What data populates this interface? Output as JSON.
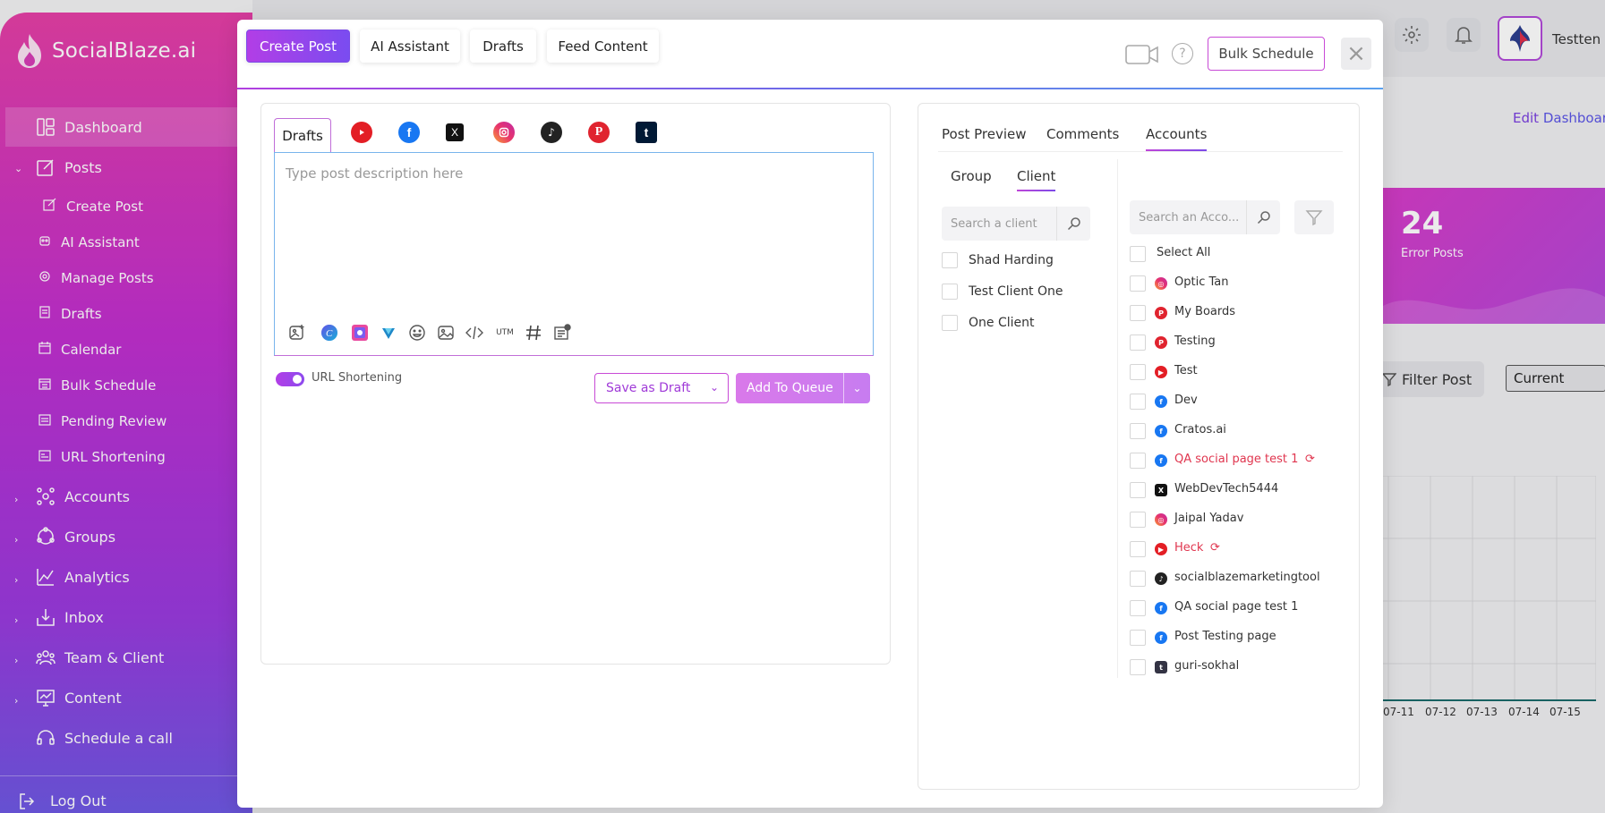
{
  "app": {
    "brand": "SocialBlaze.ai",
    "username": "Testten",
    "edit_dashboard": [
      "Edit",
      "Dashboard"
    ]
  },
  "sidebar": {
    "items": [
      {
        "label": "Dashboard",
        "icon": "dashboard-icon"
      },
      {
        "label": "Posts",
        "icon": "posts-icon"
      },
      {
        "label": "Create Post",
        "icon": "create-post-icon"
      },
      {
        "label": "AI Assistant",
        "icon": "ai-assistant-icon"
      },
      {
        "label": "Manage Posts",
        "icon": "manage-posts-icon"
      },
      {
        "label": "Drafts",
        "icon": "drafts-icon"
      },
      {
        "label": "Calendar",
        "icon": "calendar-icon"
      },
      {
        "label": "Bulk Schedule",
        "icon": "bulk-schedule-icon"
      },
      {
        "label": "Pending Review",
        "icon": "pending-review-icon"
      },
      {
        "label": "URL Shortening",
        "icon": "url-shortening-icon"
      },
      {
        "label": "Accounts",
        "icon": "accounts-icon"
      },
      {
        "label": "Groups",
        "icon": "groups-icon"
      },
      {
        "label": "Analytics",
        "icon": "analytics-icon"
      },
      {
        "label": "Inbox",
        "icon": "inbox-icon"
      },
      {
        "label": "Team & Client",
        "icon": "team-icon"
      },
      {
        "label": "Content",
        "icon": "content-icon"
      },
      {
        "label": "Schedule a call",
        "icon": "headset-icon"
      }
    ],
    "logout": "Log Out"
  },
  "background": {
    "error_count": "24",
    "error_label": "Error Posts",
    "filter_post": "Filter Post",
    "current_select": "Current",
    "x_ticks": [
      "07-11",
      "07-12",
      "07-13",
      "07-14",
      "07-15"
    ]
  },
  "modal": {
    "tabs": [
      "Create Post",
      "AI Assistant",
      "Drafts",
      "Feed Content"
    ],
    "help": "?",
    "bulk_schedule": "Bulk Schedule",
    "close": "×",
    "editor": {
      "drafts_tab": "Drafts",
      "networks": [
        "youtube",
        "facebook",
        "x",
        "instagram",
        "tiktok",
        "pinterest",
        "tumblr"
      ],
      "placeholder": "Type post description here",
      "tools": [
        "image-add-icon",
        "canva-icon",
        "design-icon",
        "vista-icon",
        "emoji-icon",
        "media-library-icon",
        "code-icon",
        "utm-icon",
        "hashtag-icon",
        "template-icon"
      ],
      "utm": "UTM",
      "url_shortening": "URL Shortening",
      "url_shortening_on": true,
      "save_draft": "Save as Draft",
      "add_to_queue": "Add To Queue"
    },
    "right": {
      "tabs": [
        "Post Preview",
        "Comments",
        "Accounts"
      ],
      "active_tab": "Accounts",
      "subtabs": [
        "Group",
        "Client"
      ],
      "active_subtab": "Client",
      "client_search_placeholder": "Search a client",
      "clients": [
        "Shad Harding",
        "Test Client One",
        "One Client"
      ],
      "account_search_placeholder": "Search an Acco...",
      "select_all": "Select All",
      "accounts": [
        {
          "name": "Optic Tan",
          "network": "instagram",
          "error": false
        },
        {
          "name": "My Boards",
          "network": "pinterest",
          "error": false
        },
        {
          "name": "Testing",
          "network": "pinterest",
          "error": false
        },
        {
          "name": "Test",
          "network": "youtube",
          "error": false
        },
        {
          "name": "Dev",
          "network": "facebook",
          "error": false
        },
        {
          "name": "Cratos.ai",
          "network": "facebook",
          "error": false
        },
        {
          "name": "QA social page test 1",
          "network": "facebook",
          "error": true
        },
        {
          "name": "WebDevTech5444",
          "network": "x",
          "error": false
        },
        {
          "name": "Jaipal Yadav",
          "network": "instagram",
          "error": false
        },
        {
          "name": "Heck",
          "network": "youtube",
          "error": true
        },
        {
          "name": "socialblazemarketingtool",
          "network": "tiktok",
          "error": false
        },
        {
          "name": "QA social page test 1",
          "network": "facebook",
          "error": false
        },
        {
          "name": "Post Testing page",
          "network": "facebook",
          "error": false
        },
        {
          "name": "guri-sokhal",
          "network": "tumblr",
          "error": false
        }
      ]
    }
  }
}
